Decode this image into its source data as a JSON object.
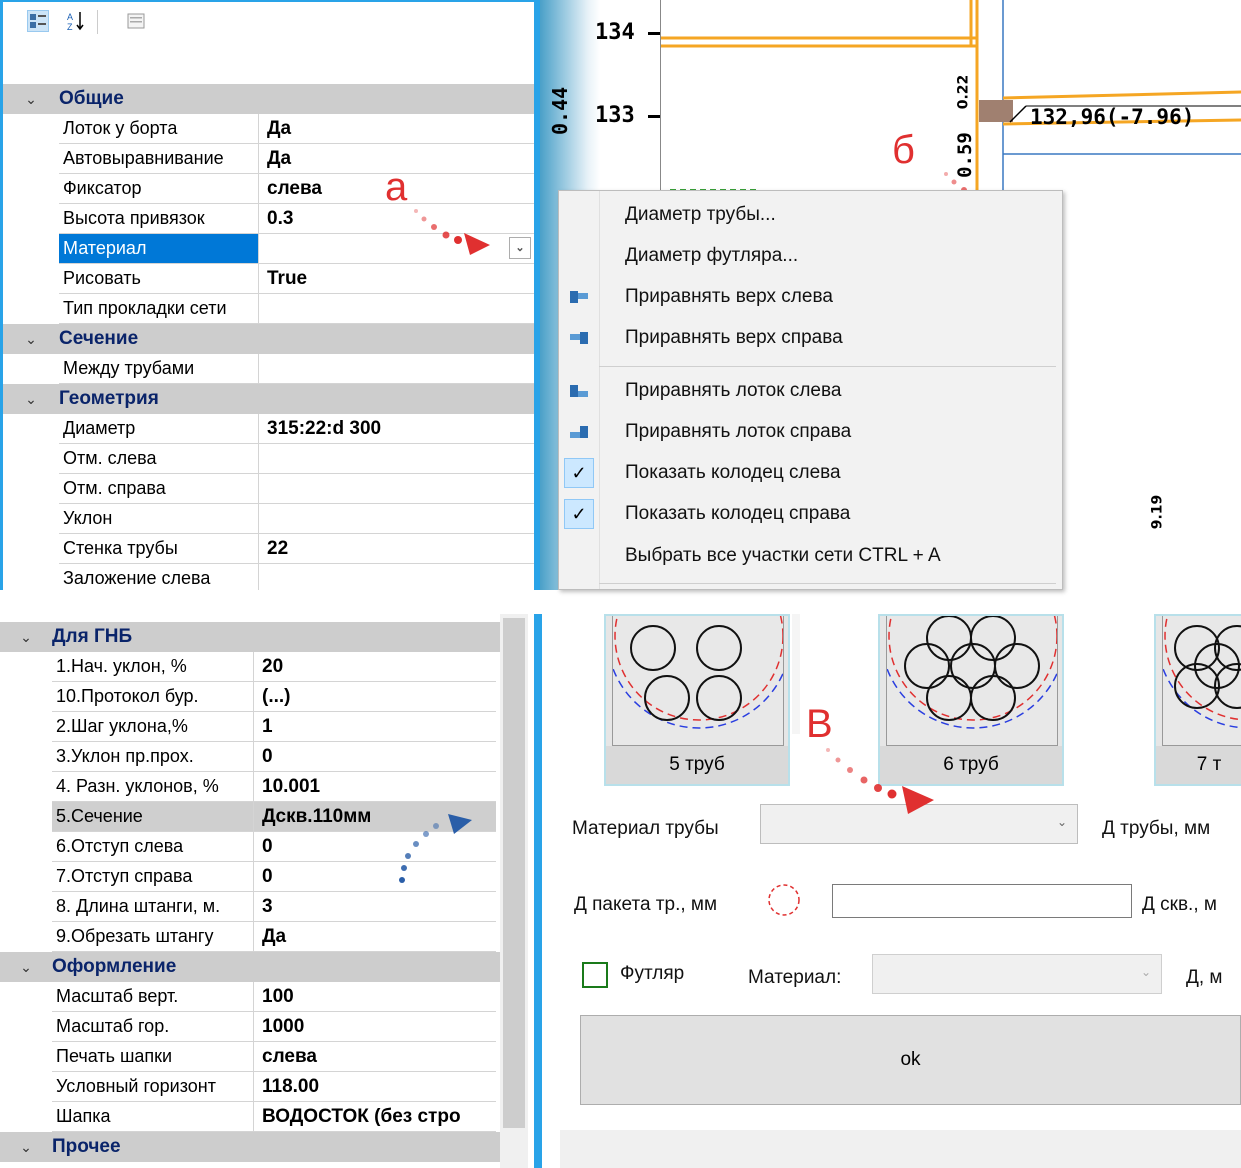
{
  "top_grid": {
    "categories": [
      {
        "label": "Общие",
        "rows": [
          {
            "name": "Лоток у борта",
            "value": "Да"
          },
          {
            "name": "Автовыравнивание",
            "value": "Да"
          },
          {
            "name": "Фиксатор",
            "value": "слева"
          },
          {
            "name": "Высота привязок",
            "value": "0.3"
          },
          {
            "name": "Материал",
            "value": ""
          },
          {
            "name": "Рисовать",
            "value": "True"
          },
          {
            "name": "Тип прокладки сети",
            "value": ""
          }
        ]
      },
      {
        "label": "Сечение",
        "rows": [
          {
            "name": "Между трубами",
            "value": ""
          }
        ]
      },
      {
        "label": "Геометрия",
        "rows": [
          {
            "name": "Диаметр",
            "value": "315:22:d 300"
          },
          {
            "name": "Отм. слева",
            "value": ""
          },
          {
            "name": "Отм. справа",
            "value": ""
          },
          {
            "name": "Уклон",
            "value": ""
          },
          {
            "name": "Стенка трубы",
            "value": "22"
          },
          {
            "name": "Заложение слева",
            "value": ""
          }
        ]
      }
    ]
  },
  "bottom_grid": {
    "categories": [
      {
        "label": "Для ГНБ",
        "rows": [
          {
            "name": "1.Нач. уклон, %",
            "value": "20"
          },
          {
            "name": "10.Протокол бур.",
            "value": "(...)"
          },
          {
            "name": "2.Шаг уклона,%",
            "value": "1"
          },
          {
            "name": "3.Уклон пр.прох.",
            "value": "0"
          },
          {
            "name": "4. Разн. уклонов, %",
            "value": "10.001"
          },
          {
            "name": "5.Сечение",
            "value": "Дскв.110мм"
          },
          {
            "name": "6.Отступ слева",
            "value": "0"
          },
          {
            "name": "7.Отступ справа",
            "value": "0"
          },
          {
            "name": "8. Длина штанги, м.",
            "value": "3"
          },
          {
            "name": "9.Обрезать штангу",
            "value": "Да"
          }
        ]
      },
      {
        "label": "Оформление",
        "rows": [
          {
            "name": "Масштаб верт.",
            "value": "100"
          },
          {
            "name": "Масштаб гор.",
            "value": "1000"
          },
          {
            "name": "Печать шапки",
            "value": "слева"
          },
          {
            "name": "Условный горизонт",
            "value": "118.00"
          },
          {
            "name": "Шапка",
            "value": "ВОДОСТОК (без стро"
          }
        ]
      },
      {
        "label": "Прочее",
        "rows": []
      }
    ]
  },
  "chart": {
    "tick_134": "134",
    "tick_133": "133",
    "side_label": "0.44",
    "label_022": "0.22",
    "label_059": "0.59",
    "mark_label": "132,96(-7.96)",
    "label_919": "9.19"
  },
  "context_menu": {
    "items": [
      {
        "label": "Диаметр трубы...",
        "icon": "none"
      },
      {
        "label": "Диаметр футляра...",
        "icon": "none"
      },
      {
        "label": "Приравнять верх слева",
        "icon": "align-top-left-icon"
      },
      {
        "label": "Приравнять верх справа",
        "icon": "align-top-right-icon"
      },
      {
        "label": "Приравнять лоток слева",
        "icon": "align-tray-left-icon"
      },
      {
        "label": "Приравнять лоток справа",
        "icon": "align-tray-right-icon"
      },
      {
        "label": "Показать колодец слева",
        "icon": "check-icon"
      },
      {
        "label": "Показать колодец справа",
        "icon": "check-icon"
      },
      {
        "label": "Выбрать все участки сети CTRL + A",
        "icon": "none"
      }
    ]
  },
  "dialog": {
    "tiles": [
      "5 труб",
      "6 труб",
      "7 т"
    ],
    "pipe_material_label": "Материал трубы",
    "pipe_d_label": "Д трубы, мм",
    "pack_d_label": "Д пакета тр., мм",
    "well_d_label": "Д скв., м",
    "case_label": "Футляр",
    "material_label": "Материал:",
    "d_label": "Д, м",
    "ok_label": "ok"
  },
  "annotations": {
    "a": "а",
    "b": "б",
    "v": "В"
  },
  "colors": {
    "accent_orange": "#f5a623",
    "selection_blue": "#0078d7",
    "annotation_red": "#e03030",
    "category_text": "#0a246a",
    "separator_blue": "#29a3e8"
  }
}
